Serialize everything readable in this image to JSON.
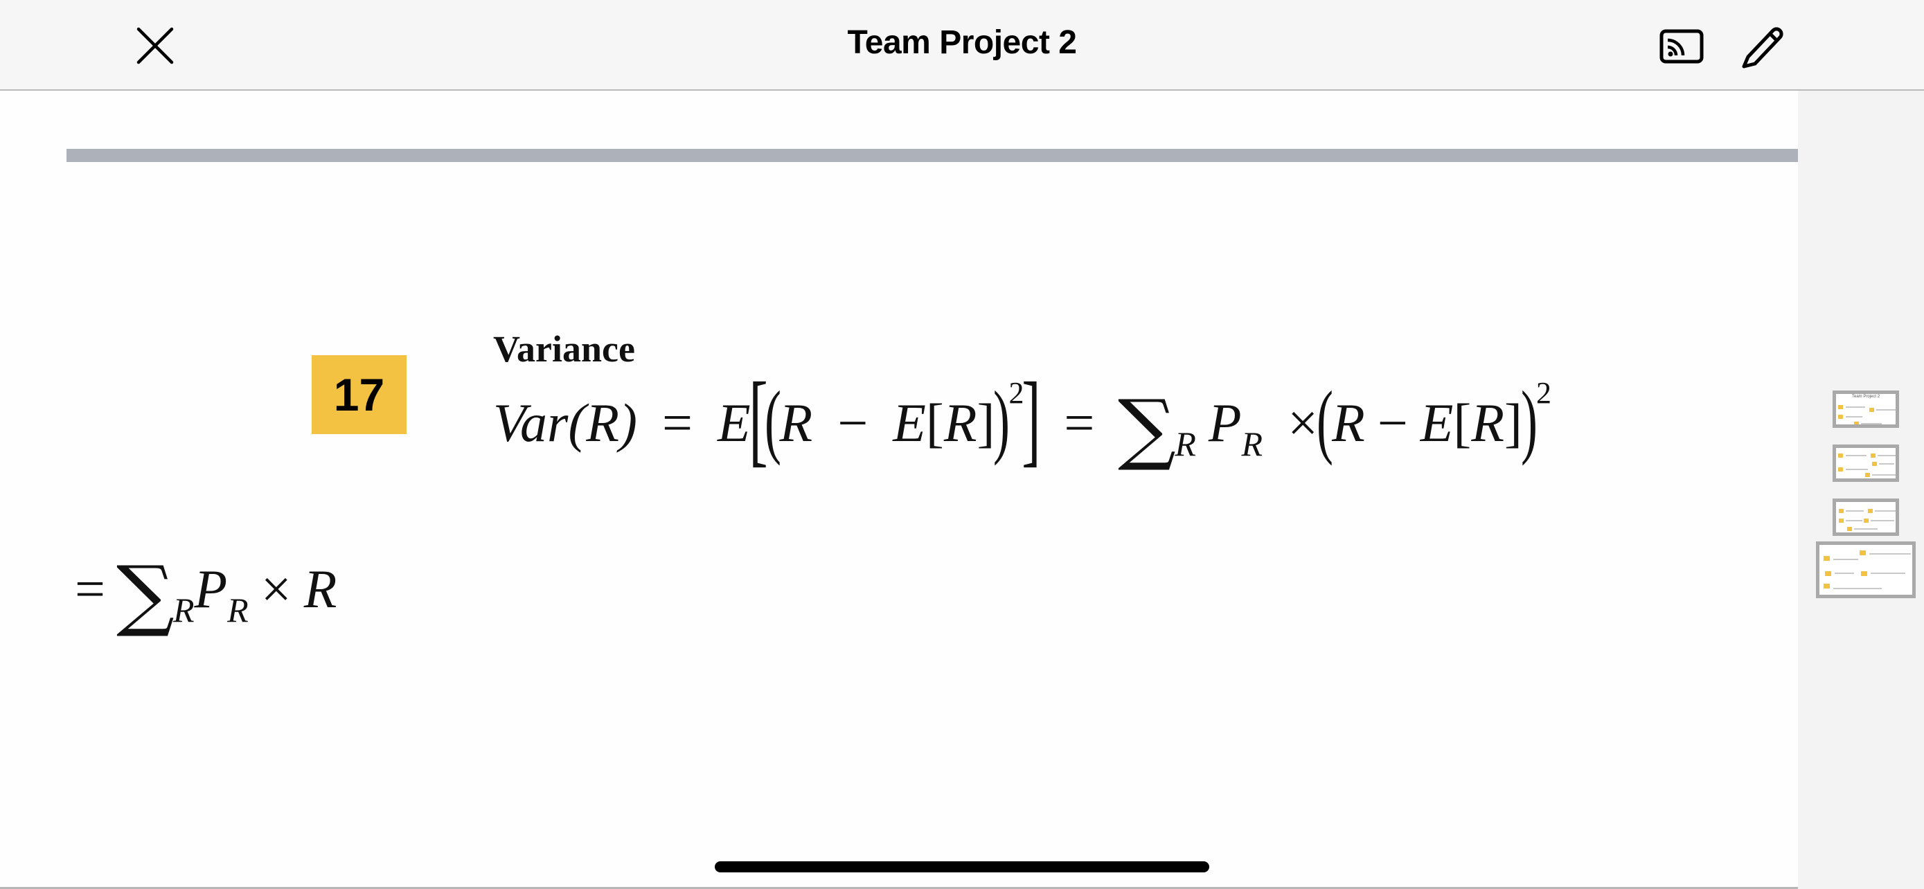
{
  "header": {
    "title": "Team Project 2",
    "close_icon": "close-icon",
    "cast_icon": "cast-icon",
    "edit_icon": "pencil-icon"
  },
  "document": {
    "slide_badge": "17",
    "section_heading": "Variance",
    "formula_1": {
      "lhs": "Var(R)",
      "eq": "=",
      "expectation_symbol": "E",
      "inner_R": "R",
      "minus": "−",
      "inner_E": "E",
      "inner_R2": "R",
      "exponent": "2",
      "sum_symbol": "∑",
      "sum_sub": "R",
      "prob": "P",
      "prob_sub": "R",
      "times": "×",
      "R3": "R",
      "E3": "E",
      "R4": "R",
      "exponent2": "2"
    },
    "formula_2": {
      "eq": "=",
      "sum_symbol": "∑",
      "sum_sub": "R",
      "prob": "P",
      "prob_sub": "R",
      "times": "×",
      "R": "R"
    }
  },
  "thumbnails": {
    "items": [
      {
        "title": "Team Project 2",
        "selected": false
      },
      {
        "title": "",
        "selected": false
      },
      {
        "title": "",
        "selected": false
      },
      {
        "title": "",
        "selected": true
      }
    ]
  },
  "colors": {
    "badge": "#f4c242",
    "rule_bar": "#adb1b9",
    "topbar_bg": "#f6f6f6",
    "thumb_rail_bg": "#f3f3f3"
  }
}
